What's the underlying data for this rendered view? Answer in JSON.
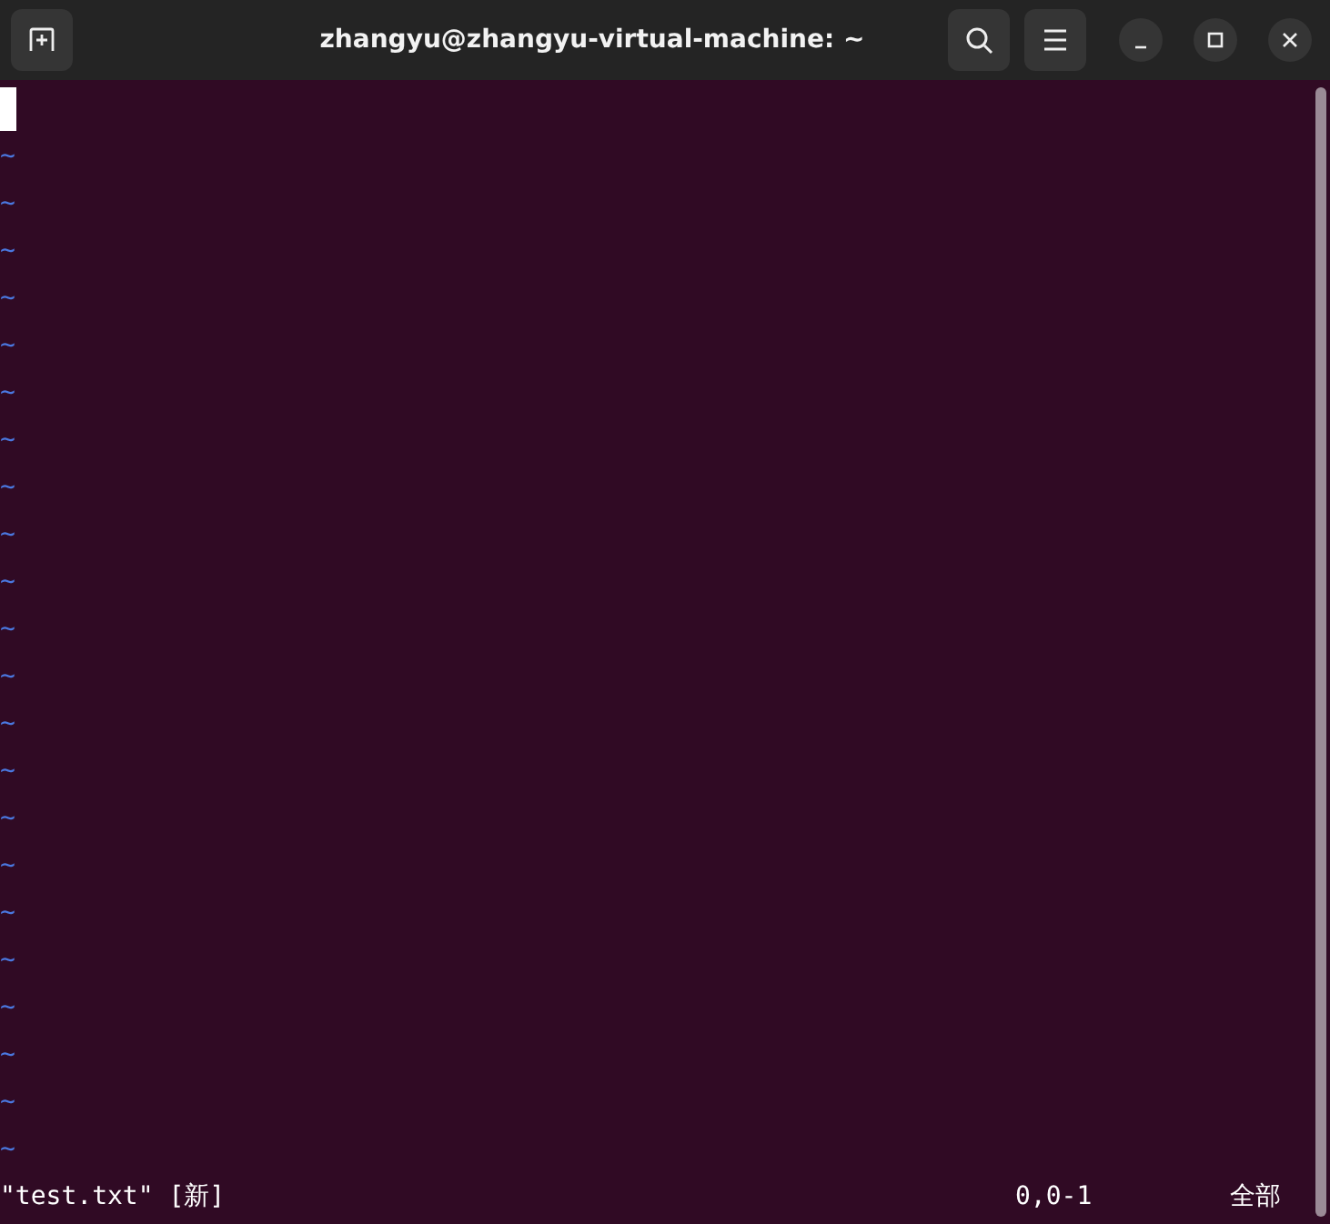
{
  "window": {
    "title": "zhangyu@zhangyu-virtual-machine: ~"
  },
  "editor": {
    "empty_lines": [
      "~",
      "~",
      "~",
      "~",
      "~",
      "~",
      "~",
      "~",
      "~",
      "~",
      "~",
      "~",
      "~",
      "~",
      "~",
      "~",
      "~",
      "~",
      "~",
      "~",
      "~",
      "~"
    ]
  },
  "status_bar": {
    "message": "\"test.txt\" [新]",
    "position": "0,0-1",
    "scroll": "全部"
  }
}
